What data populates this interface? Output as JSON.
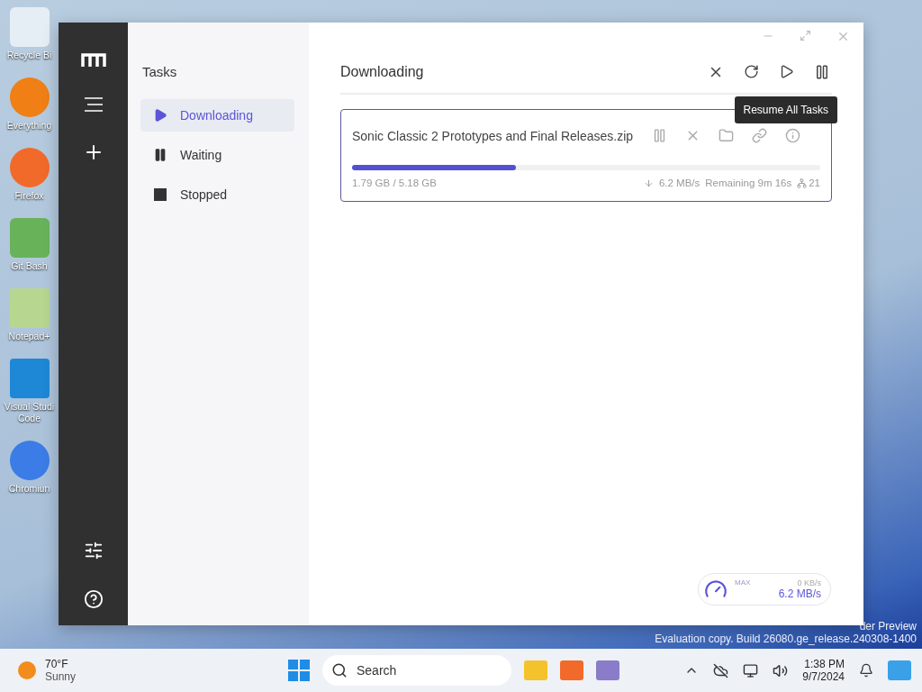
{
  "desktop": {
    "icons": [
      {
        "label": "Recycle Bi",
        "kind": "bin"
      },
      {
        "label": "Everything",
        "kind": "search"
      },
      {
        "label": "Firefox",
        "kind": "firefox"
      },
      {
        "label": "Git Bash",
        "kind": "git"
      },
      {
        "label": "Notepad+",
        "kind": "notepad"
      },
      {
        "label": "Visual Studi Code",
        "kind": "vscode"
      },
      {
        "label": "Chromiun",
        "kind": "chromium"
      }
    ],
    "watermark": [
      "der Preview",
      "Evaluation copy. Build 26080.ge_release.240308-1400"
    ]
  },
  "window": {
    "sidebar": {
      "title": "Tasks",
      "items": [
        {
          "label": "Downloading",
          "kind": "play",
          "selected": true
        },
        {
          "label": "Waiting",
          "kind": "pause",
          "selected": false
        },
        {
          "label": "Stopped",
          "kind": "stop",
          "selected": false
        }
      ]
    },
    "main": {
      "title": "Downloading",
      "tooltip": "Resume All Tasks",
      "tasks": [
        {
          "name": "Sonic Classic 2 Prototypes and Final Releases.zip",
          "level": 0.35,
          "size": "1.79 GB / 5.18 GB",
          "speed": "6.2 MB/s",
          "remaining": "Remaining 9m 16s",
          "peers": "21"
        }
      ]
    },
    "speed_widget": {
      "label": "MAX",
      "upload": "0 KB/s",
      "download": "6.2 MB/s"
    }
  },
  "taskbar": {
    "temperature": "70°F",
    "condition": "Sunny",
    "search_placeholder": "Search",
    "time": "1:38 PM",
    "date": "9/7/2024"
  }
}
